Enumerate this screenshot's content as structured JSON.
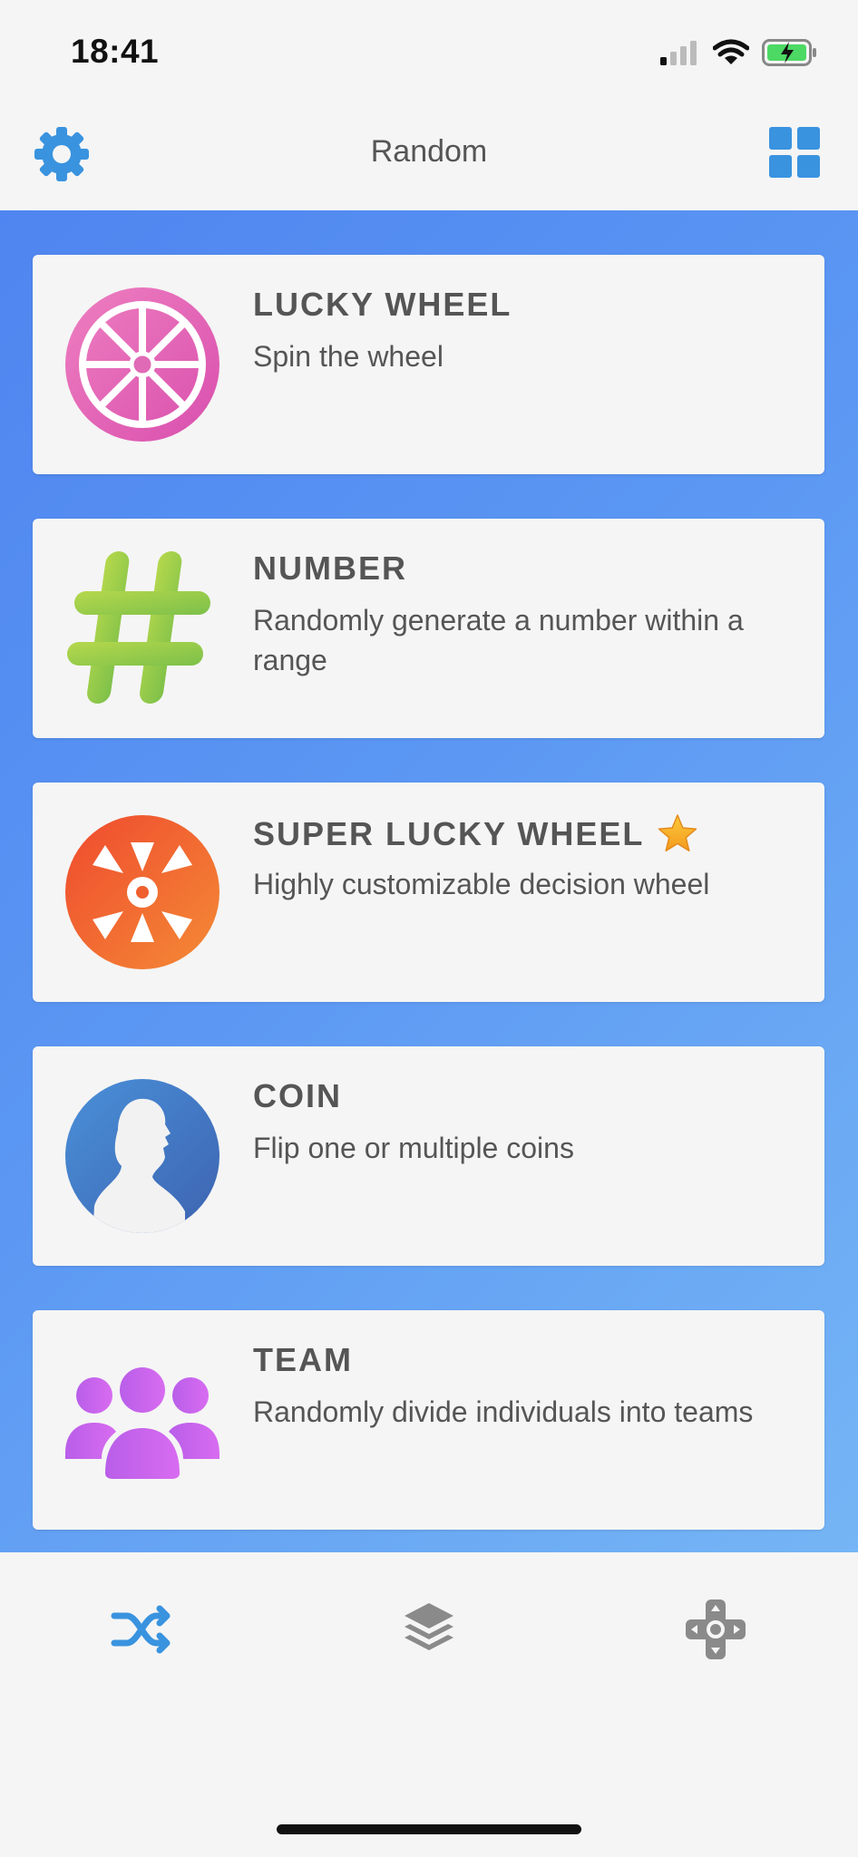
{
  "status_bar": {
    "time": "18:41"
  },
  "nav": {
    "title": "Random",
    "left_icon": "gear-icon",
    "right_icon": "grid-icon",
    "accent_color": "#3a93df"
  },
  "cards": [
    {
      "title": "LUCKY WHEEL",
      "description": "Spin the wheel",
      "icon": "lucky-wheel-icon"
    },
    {
      "title": "NUMBER",
      "description": "Randomly generate a number within a range",
      "icon": "hashtag-icon"
    },
    {
      "title": "SUPER LUCKY WHEEL",
      "description": "Highly customizable decision wheel",
      "icon": "super-wheel-icon",
      "badge": "star-icon"
    },
    {
      "title": "COIN",
      "description": "Flip one or multiple coins",
      "icon": "coin-icon"
    },
    {
      "title": "TEAM",
      "description": "Randomly divide individuals into teams",
      "icon": "team-icon"
    }
  ],
  "tab_bar": {
    "tabs": [
      {
        "icon": "shuffle-icon",
        "active": true
      },
      {
        "icon": "layers-icon",
        "active": false
      },
      {
        "icon": "gamepad-icon",
        "active": false
      }
    ]
  }
}
